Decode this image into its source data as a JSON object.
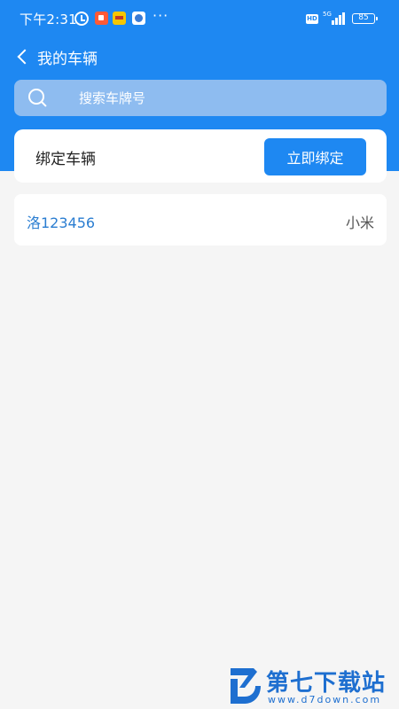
{
  "status_bar": {
    "time": "下午2:31",
    "more": "···",
    "hd": "HD",
    "network": "5G",
    "battery": "85"
  },
  "header": {
    "title": "我的车辆"
  },
  "search": {
    "placeholder": "搜索车牌号"
  },
  "bind": {
    "label": "绑定车辆",
    "button_label": "立即绑定"
  },
  "vehicles": [
    {
      "plate": "洛123456",
      "brand": "小米"
    }
  ],
  "watermark": {
    "title": "第七下载站",
    "url": "www.d7down.com"
  },
  "colors": {
    "primary": "#1e88f2",
    "background": "#f5f5f5",
    "plate_text": "#2a7dd1"
  }
}
